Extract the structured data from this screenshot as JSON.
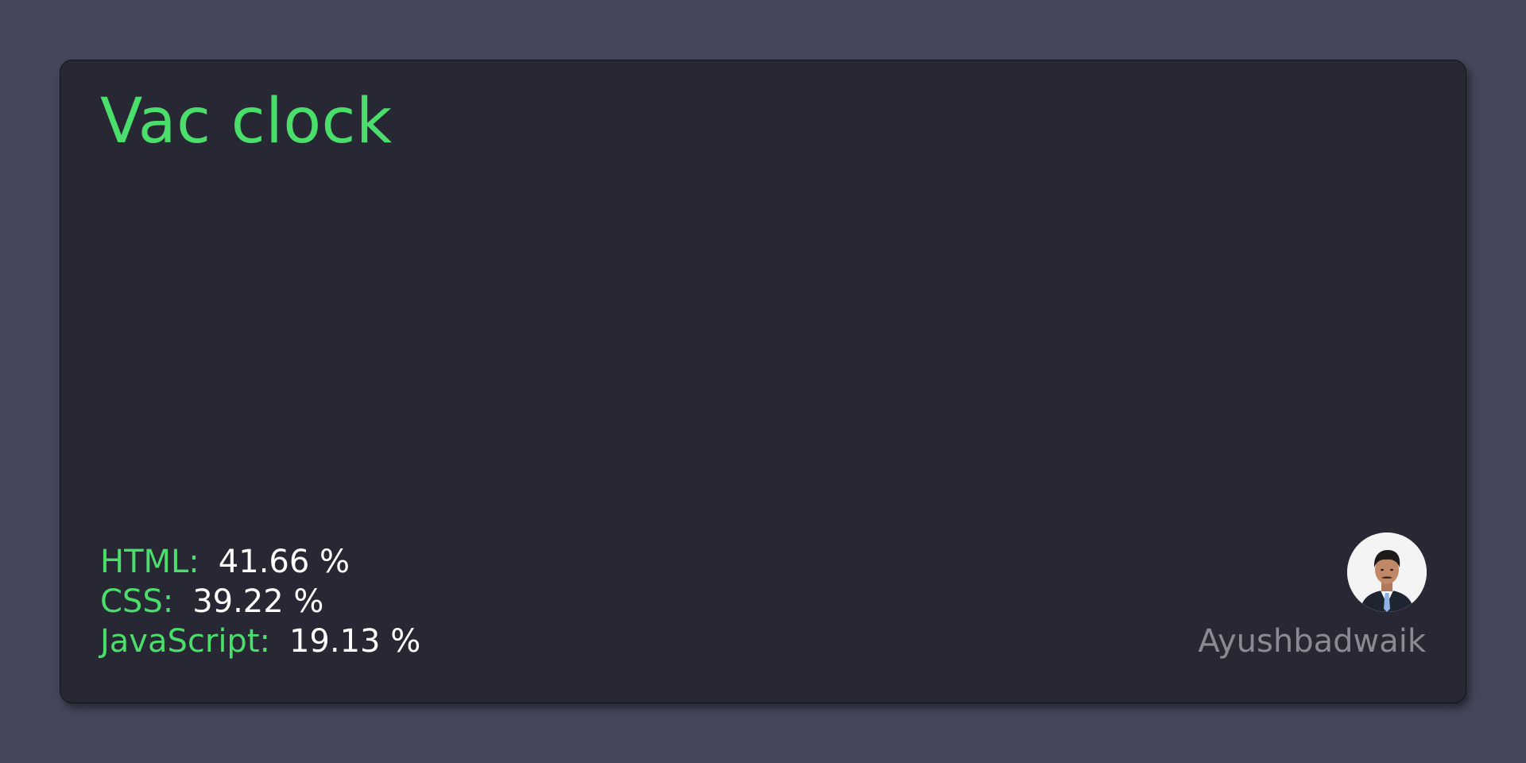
{
  "title": "Vac clock",
  "languages": [
    {
      "label": "HTML:",
      "value": "41.66 %"
    },
    {
      "label": "CSS:",
      "value": "39.22 %"
    },
    {
      "label": "JavaScript:",
      "value": "19.13 %"
    }
  ],
  "author": {
    "name": "Ayushbadwaik",
    "avatar_icon": "profile-photo"
  },
  "colors": {
    "background": "#434759",
    "card": "#282835",
    "accent": "#4ade6b",
    "value_text": "#ffffff",
    "muted_text": "#8a8a93"
  }
}
